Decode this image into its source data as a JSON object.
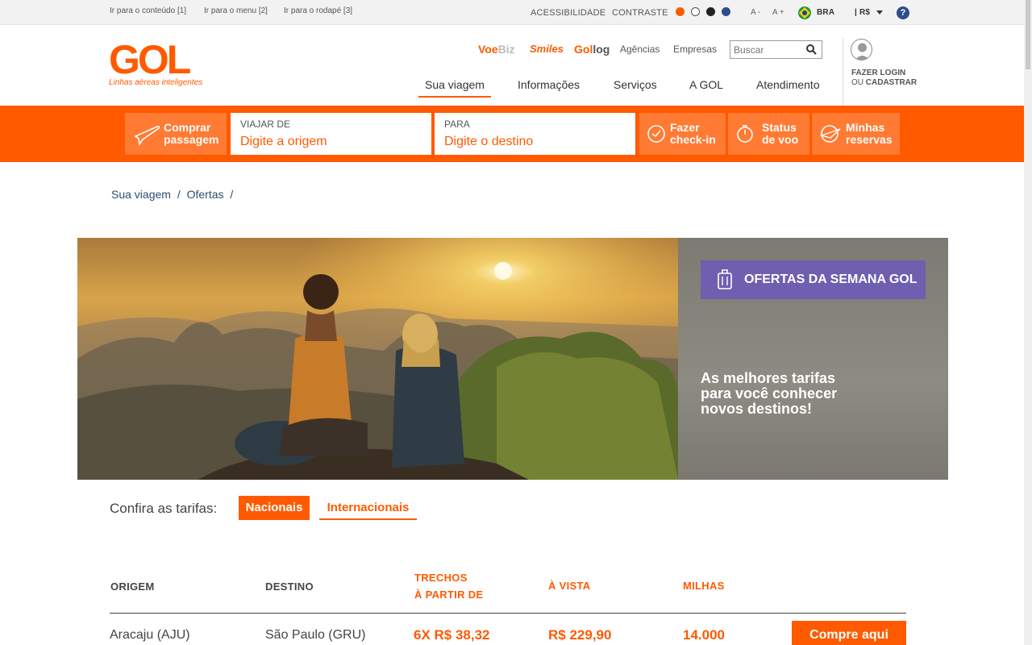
{
  "topbar": {
    "skip_links": [
      "Ir para o conteúdo [1]",
      "Ir para o menu [2]",
      "Ir para o rodapé [3]"
    ],
    "acessibilidade": "ACESSIBILIDADE",
    "contraste": "CONTRASTE",
    "contrast_colors": [
      "#ff5a00",
      "#ffffff",
      "#222222",
      "#2c4d8a"
    ],
    "font_smaller": "A -",
    "font_larger": "A +",
    "country": "BRA",
    "currency": "| R$",
    "help": "?"
  },
  "header": {
    "logo_text": "GOL",
    "logo_tagline": "Linhas aéreas inteligentes",
    "brands": {
      "voebiz_a": "Voe",
      "voebiz_b": "Biz",
      "smiles": "Smiles",
      "gollog_a": "Gol",
      "gollog_b": "log"
    },
    "links": [
      "Agências",
      "Empresas"
    ],
    "search_placeholder": "Buscar",
    "nav": [
      "Sua viagem",
      "Informações",
      "Serviços",
      "A GOL",
      "Atendimento"
    ],
    "login_line1": "FAZER LOGIN",
    "login_line2_prefix": "OU ",
    "login_line2_bold": "CADASTRAR"
  },
  "booking": {
    "comprar_line1": "Comprar",
    "comprar_line2": "passagem",
    "from_label": "VIAJAR DE",
    "from_placeholder": "Digite a origem",
    "to_label": "PARA",
    "to_placeholder": "Digite o destino",
    "checkin_line1": "Fazer",
    "checkin_line2": "check-in",
    "status_line1": "Status",
    "status_line2": "de voo",
    "reservas_line1": "Minhas",
    "reservas_line2": "reservas"
  },
  "breadcrumb": {
    "item1": "Sua viagem",
    "sep": "/",
    "item2": "Ofertas"
  },
  "hero": {
    "badge": "OFERTAS DA SEMANA GOL",
    "text": "As melhores tarifas para você conhecer novos destinos!"
  },
  "tariffs": {
    "label": "Confira as tarifas:",
    "tab_nacionais": "Nacionais",
    "tab_internacionais": "Internacionais",
    "headers": {
      "origem": "ORIGEM",
      "destino": "DESTINO",
      "trechos_1": "TRECHOS",
      "trechos_2": "À PARTIR DE",
      "avista": "À VISTA",
      "milhas": "MILHAS"
    },
    "rows": [
      {
        "origem": "Aracaju (AJU)",
        "destino": "São Paulo (GRU)",
        "trechos": "6X R$ 38,32",
        "avista": "R$ 229,90",
        "milhas": "14.000",
        "button": "Compre aqui"
      }
    ]
  },
  "colors": {
    "brand_orange": "#ff5a00",
    "badge_purple": "#6e5fb0",
    "link_blue": "#2c4d6e"
  }
}
